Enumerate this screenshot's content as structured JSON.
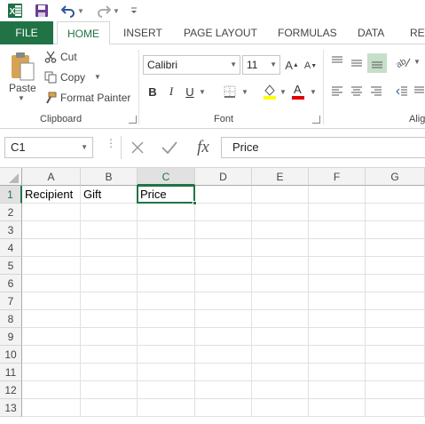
{
  "quick_access": {
    "excel_icon": "excel-logo-icon",
    "save_icon": "save-icon",
    "undo_icon": "undo-icon",
    "redo_icon": "redo-icon",
    "customize_icon": "customize-qat-icon"
  },
  "tabs": [
    {
      "label": "FILE"
    },
    {
      "label": "HOME"
    },
    {
      "label": "INSERT"
    },
    {
      "label": "PAGE LAYOUT"
    },
    {
      "label": "FORMULAS"
    },
    {
      "label": "DATA"
    },
    {
      "label": "REV"
    }
  ],
  "ribbon": {
    "clipboard": {
      "paste_label": "Paste",
      "cut_label": "Cut",
      "copy_label": "Copy",
      "format_painter_label": "Format Painter",
      "group_label": "Clipboard"
    },
    "font": {
      "font_name": "Calibri",
      "font_size": "11",
      "bold": "B",
      "italic": "I",
      "underline": "U",
      "group_label": "Font"
    },
    "alignment": {
      "group_label": "Alig"
    }
  },
  "formula_bar": {
    "name_box": "C1",
    "cancel_icon": "cancel-x-icon",
    "enter_icon": "enter-check-icon",
    "fx_label": "fx",
    "formula_value": "Price"
  },
  "sheet": {
    "columns": [
      "A",
      "B",
      "C",
      "D",
      "E",
      "F",
      "G"
    ],
    "rows": [
      "1",
      "2",
      "3",
      "4",
      "5",
      "6",
      "7",
      "8",
      "9",
      "10",
      "11",
      "12",
      "13"
    ],
    "cells": {
      "A1": "Recipient",
      "B1": "Gift",
      "C1": "Price"
    },
    "selected_cell": "C1",
    "accent_color": "#217346"
  }
}
